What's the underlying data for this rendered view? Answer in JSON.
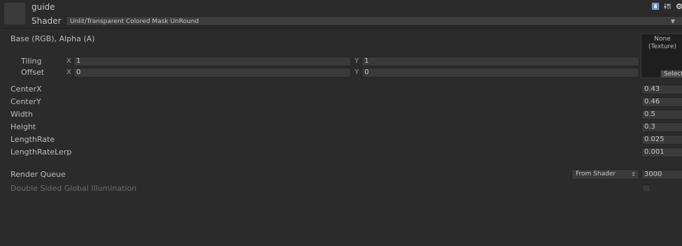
{
  "header": {
    "material_name": "guide",
    "shader_label": "Shader",
    "shader_value": "Unlit/Transparent Colored Mask UnRound",
    "icons": [
      "help-icon",
      "presets-icon",
      "settings-icon"
    ]
  },
  "texture": {
    "label": "Base (RGB), Alpha (A)",
    "slot_line1": "None",
    "slot_line2": "(Texture)",
    "select_label": "Select",
    "tiling": {
      "label": "Tiling",
      "x_label": "X",
      "x": "1",
      "y_label": "Y",
      "y": "1"
    },
    "offset": {
      "label": "Offset",
      "x_label": "X",
      "x": "0",
      "y_label": "Y",
      "y": "0"
    }
  },
  "properties": [
    {
      "label": "CenterX",
      "value": "0.43"
    },
    {
      "label": "CenterY",
      "value": "0.46"
    },
    {
      "label": "Width",
      "value": "0.5"
    },
    {
      "label": "Height",
      "value": "0.3"
    },
    {
      "label": "LengthRate",
      "value": "0.025"
    },
    {
      "label": "LengthRateLerp",
      "value": "0.001"
    }
  ],
  "render_queue": {
    "label": "Render Queue",
    "mode": "From Shader",
    "value": "3000"
  },
  "double_sided_gi": {
    "label": "Double Sided Global Illumination",
    "checked": false
  },
  "colors": {
    "background": "#2b2b2b",
    "field": "#3a3a3a",
    "text": "#bdbdbd",
    "dim_text": "#6d6d6d"
  }
}
